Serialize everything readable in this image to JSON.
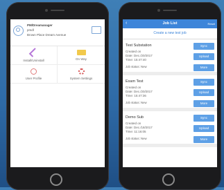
{
  "left_screen": {
    "profile": {
      "role": "PM/Dreamanager",
      "username": "pmdl",
      "address": "Brown Place Dream Avenue"
    },
    "grid": [
      {
        "label": "Install/Uninstall",
        "icon": "wrench-icon"
      },
      {
        "label": "On Way",
        "icon": "truck-icon"
      },
      {
        "label": "User Profile",
        "icon": "user-icon"
      },
      {
        "label": "System Settings",
        "icon": "gear-icon"
      }
    ]
  },
  "right_screen": {
    "nav": {
      "back": "‹",
      "title": "Job List",
      "right": "Reset"
    },
    "create_label": "Create a new test job",
    "jobs": [
      {
        "title": "Test Substation",
        "created_label": "Created on",
        "date": "Date: Dec./20/2017",
        "time": "Time: 15:47:40",
        "status": "Job status: New",
        "buttons": [
          "Sync",
          "Upload",
          "More"
        ]
      },
      {
        "title": "Exam Test",
        "created_label": "Created on",
        "date": "Date: Dec./20/2017",
        "time": "Time: 15:47:36",
        "status": "Job status: New",
        "buttons": [
          "Sync",
          "Upload",
          "More"
        ]
      },
      {
        "title": "Demo Sub",
        "created_label": "Created on",
        "date": "Date: Dec./18/2017",
        "time": "Time: 11:16:05",
        "status": "Job status: New",
        "buttons": [
          "Sync",
          "Upload",
          "More"
        ]
      }
    ]
  },
  "colors": {
    "accent": "#3d85d9",
    "button": "#5ea0e6",
    "background": "#2e6aa6"
  }
}
